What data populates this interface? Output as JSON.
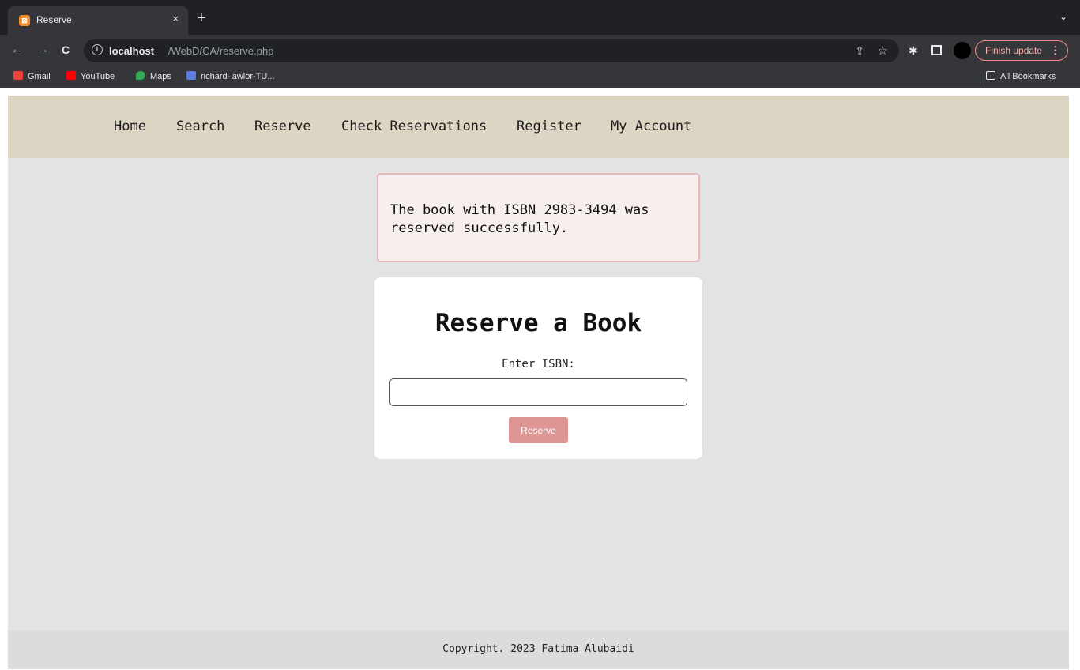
{
  "browser": {
    "tab_title": "Reserve",
    "tab_close": "×",
    "new_tab": "+",
    "url_host": "localhost",
    "url_path": "/WebD/CA/reserve.php",
    "finish_update_label": "Finish update",
    "back_icon": "←",
    "forward_icon": "→",
    "reload_icon": "C",
    "bookmarks": [
      {
        "label": "Gmail",
        "color": "#ea4335"
      },
      {
        "label": "YouTube",
        "color": "#ff0000"
      },
      {
        "label": "Maps",
        "color": "#34a853"
      },
      {
        "label": "richard-lawlor-TU...",
        "color": "#5b7de0"
      }
    ],
    "all_bookmarks_label": "All Bookmarks"
  },
  "site": {
    "nav": [
      "Home",
      "Search",
      "Reserve",
      "Check Reservations",
      "Register",
      "My Account"
    ],
    "alert_message": "The book with ISBN 2983-3494 was reserved successfully.",
    "form": {
      "title": "Reserve a Book",
      "label": "Enter ISBN:",
      "input_value": "",
      "button_label": "Reserve"
    },
    "footer": "Copyright. 2023 Fatima Alubaidi"
  },
  "colors": {
    "nav_bg": "#ddd5c4",
    "page_bg": "#e4e3e3",
    "alert_bg": "#f7eeee",
    "alert_border": "#e7b7bb",
    "button": "#e09595"
  }
}
